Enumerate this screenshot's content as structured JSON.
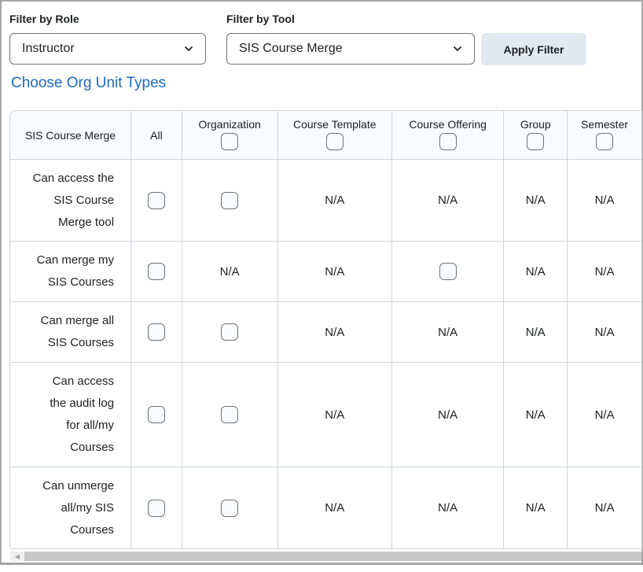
{
  "filters": {
    "role_label": "Filter by Role",
    "role_value": "Instructor",
    "tool_label": "Filter by Tool",
    "tool_value": "SIS Course Merge",
    "apply_label": "Apply Filter"
  },
  "org_unit_link": "Choose Org Unit Types",
  "table": {
    "corner_header": "SIS Course Merge",
    "all_header": "All",
    "columns": [
      {
        "label": "Organization",
        "checked": false
      },
      {
        "label": "Course Template",
        "checked": false
      },
      {
        "label": "Course Offering",
        "checked": false
      },
      {
        "label": "Group",
        "checked": false
      },
      {
        "label": "Semester",
        "checked": false
      }
    ],
    "rows": [
      {
        "label": "Can access the SIS Course Merge tool",
        "lines": [
          "Can access the",
          "SIS Course",
          "Merge tool"
        ],
        "all": "checkbox",
        "cells": [
          "checkbox",
          "N/A",
          "N/A",
          "N/A",
          "N/A"
        ]
      },
      {
        "label": "Can merge my SIS Courses",
        "lines": [
          "Can merge my",
          "SIS Courses"
        ],
        "all": "checkbox",
        "cells": [
          "N/A",
          "N/A",
          "checkbox",
          "N/A",
          "N/A"
        ]
      },
      {
        "label": "Can merge all SIS Courses",
        "lines": [
          "Can merge all",
          "SIS Courses"
        ],
        "all": "checkbox",
        "cells": [
          "checkbox",
          "N/A",
          "N/A",
          "N/A",
          "N/A"
        ]
      },
      {
        "label": "Can access the audit log for all/my Courses",
        "lines": [
          "Can access",
          "the audit log",
          "for all/my",
          "Courses"
        ],
        "all": "checkbox",
        "cells": [
          "checkbox",
          "N/A",
          "N/A",
          "N/A",
          "N/A"
        ]
      },
      {
        "label": "Can unmerge all/my SIS Courses",
        "lines": [
          "Can unmerge",
          "all/my SIS",
          "Courses"
        ],
        "all": "checkbox",
        "cells": [
          "checkbox",
          "N/A",
          "N/A",
          "N/A",
          "N/A"
        ]
      }
    ]
  },
  "icons": {
    "chevron": "chevron-down-icon",
    "scroll_left": "scroll-left-arrow-icon"
  }
}
